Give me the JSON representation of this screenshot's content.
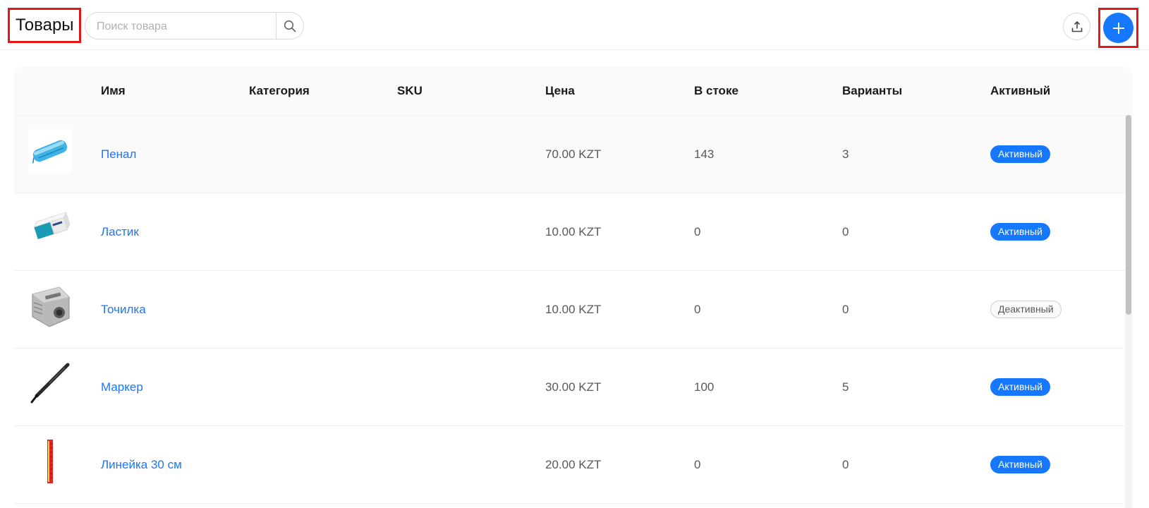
{
  "header": {
    "title": "Товары",
    "search_placeholder": "Поиск товара",
    "search_value": "",
    "export_icon": "upload-icon",
    "add_icon": "plus-icon"
  },
  "table": {
    "columns": [
      "",
      "Имя",
      "Категория",
      "SKU",
      "Цена",
      "В стоке",
      "Варианты",
      "Активный"
    ],
    "rows": [
      {
        "image": "pencil-case-image",
        "name": "Пенал",
        "category": "",
        "sku": "",
        "price": "70.00 KZT",
        "stock": "143",
        "variants": "3",
        "status": "Активный",
        "active": true
      },
      {
        "image": "eraser-image",
        "name": "Ластик",
        "category": "",
        "sku": "",
        "price": "10.00 KZT",
        "stock": "0",
        "variants": "0",
        "status": "Активный",
        "active": true
      },
      {
        "image": "sharpener-image",
        "name": "Точилка",
        "category": "",
        "sku": "",
        "price": "10.00 KZT",
        "stock": "0",
        "variants": "0",
        "status": "Деактивный",
        "active": false
      },
      {
        "image": "marker-image",
        "name": "Маркер",
        "category": "",
        "sku": "",
        "price": "30.00 KZT",
        "stock": "100",
        "variants": "5",
        "status": "Активный",
        "active": true
      },
      {
        "image": "ruler-image",
        "name": "Линейка 30 см",
        "category": "",
        "sku": "",
        "price": "20.00 KZT",
        "stock": "0",
        "variants": "0",
        "status": "Активный",
        "active": true
      }
    ]
  },
  "colors": {
    "accent": "#1677ff",
    "highlight_frame": "#e0181a",
    "inactive_tag_border": "#cfcfcf"
  }
}
